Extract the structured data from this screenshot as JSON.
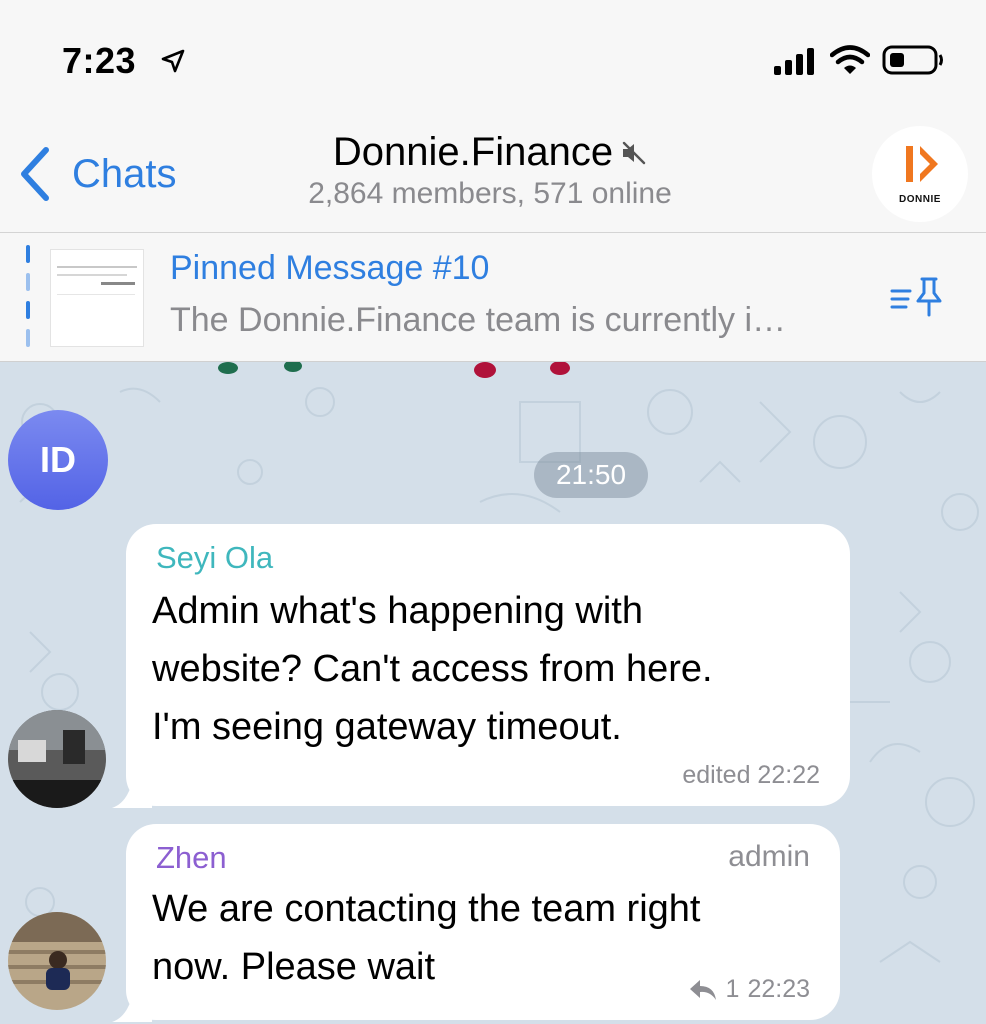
{
  "status_bar": {
    "time": "7:23",
    "icons": [
      "location-arrow-icon",
      "cellular-signal-icon",
      "wifi-icon",
      "battery-icon"
    ]
  },
  "header": {
    "back_label": "Chats",
    "title": "Donnie.Finance",
    "title_icon": "mute-icon",
    "subtitle": "2,864 members, 571 online",
    "avatar_text": "DONNIE",
    "accent_color": "#2f7fe0"
  },
  "pinned": {
    "title": "Pinned Message #10",
    "text": "The Donnie.Finance team is currently i…",
    "thumbnail_text": "504 Gateway"
  },
  "chat": {
    "date_pill": "21:50",
    "avatar_initials": "ID",
    "messages": [
      {
        "sender": "Seyi Ola",
        "sender_color": "#3fb7bd",
        "lines": [
          "Admin what's happening with",
          "website? Can't access from here.",
          "I'm seeing gateway timeout."
        ],
        "meta": "edited 22:22"
      },
      {
        "sender": "Zhen",
        "sender_color": "#8c5fd1",
        "role": "admin",
        "lines": [
          "We are contacting the team right",
          "now. Please wait"
        ],
        "reply_count": "1",
        "time": "22:23"
      }
    ]
  }
}
